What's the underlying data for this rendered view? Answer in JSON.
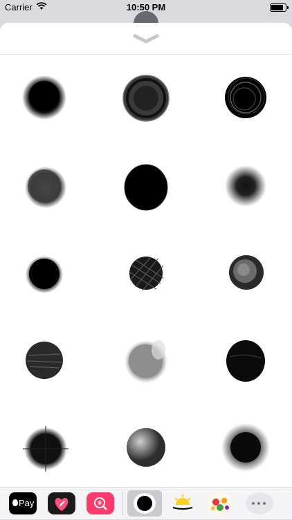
{
  "status_bar": {
    "carrier": "Carrier",
    "time": "10:50 PM",
    "icons": [
      "wifi-icon",
      "battery-icon"
    ]
  },
  "sticker_sheet": {
    "grabber_icon": "chevron-down-icon",
    "stickers": [
      {
        "style": "soft-solid"
      },
      {
        "style": "ringed"
      },
      {
        "style": "scribble-ring"
      },
      {
        "style": "grainy-gray"
      },
      {
        "style": "dense-hatched"
      },
      {
        "style": "airbrush"
      },
      {
        "style": "solid-drip"
      },
      {
        "style": "crosshatch"
      },
      {
        "style": "gray-swirl"
      },
      {
        "style": "streaked-gray"
      },
      {
        "style": "light-gray-smudge"
      },
      {
        "style": "brushed-black"
      },
      {
        "style": "fuzzy"
      },
      {
        "style": "shaded-sphere"
      },
      {
        "style": "airbrush-large"
      }
    ]
  },
  "app_drawer": {
    "apple_pay_label": "Pay",
    "apps": [
      "apple-pay-icon",
      "heart-app-icon",
      "search-app-icon",
      "black-circle-sticker-icon",
      "sunrise-app-icon",
      "vegetables-app-icon",
      "more-icon"
    ],
    "colors": {
      "search_app": "#ff3b6b",
      "drawer_bg": "#f4f4f6"
    }
  }
}
